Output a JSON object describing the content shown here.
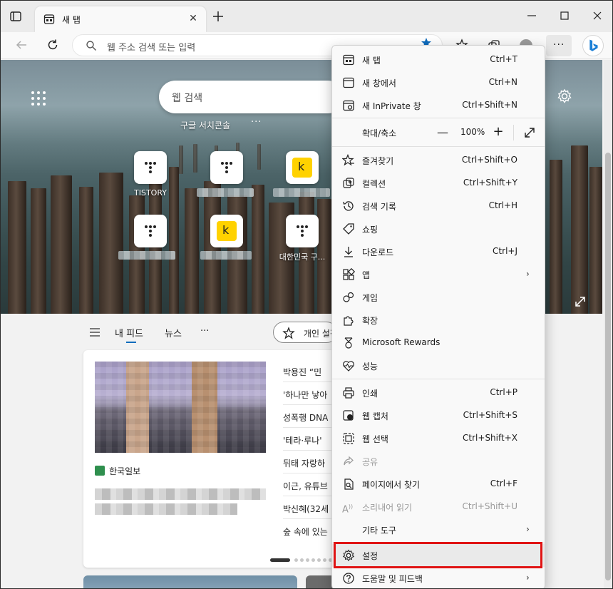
{
  "tab": {
    "title": "새 탭"
  },
  "address": {
    "placeholder": "웹 주소 검색 또는 입력"
  },
  "newtab": {
    "search_placeholder": "웹 검색",
    "search_sub": "구글 서치콘솔",
    "search_sub_more": "···",
    "tiles": [
      {
        "label": "TISTORY",
        "icon": "tistory-icon"
      },
      {
        "label": "",
        "icon": "tistory-icon"
      },
      {
        "label": "",
        "icon": "kakao-icon"
      },
      {
        "label": "",
        "icon": "tistory-icon"
      },
      {
        "label": "",
        "icon": "kakao-icon"
      },
      {
        "label": "대한민국 구...",
        "icon": "tistory-icon"
      }
    ]
  },
  "feed": {
    "tabs": [
      "내 피드",
      "뉴스"
    ],
    "more": "···",
    "personalize": "개인 설정",
    "publisher": "한국일보",
    "headlines": [
      "박용진 “민",
      "'하나만 낳아",
      "성폭행 DNA",
      "'테라·루나'",
      "뒤태 자랑하",
      "이근, 유튜브",
      "박신혜(32세",
      "숲 속에 있는"
    ]
  },
  "menu": {
    "items": [
      {
        "label": "새 탭",
        "shortcut": "Ctrl+T",
        "icon": "new-tab-icon"
      },
      {
        "label": "새 창에서",
        "shortcut": "Ctrl+N",
        "icon": "new-window-icon"
      },
      {
        "label": "새 InPrivate 창",
        "shortcut": "Ctrl+Shift+N",
        "icon": "inprivate-icon"
      },
      {
        "label": "확대/축소",
        "zoom": "100%",
        "icon": ""
      },
      {
        "label": "즐겨찾기",
        "shortcut": "Ctrl+Shift+O",
        "icon": "favorites-icon"
      },
      {
        "label": "컬렉션",
        "shortcut": "Ctrl+Shift+Y",
        "icon": "collections-icon"
      },
      {
        "label": "검색 기록",
        "shortcut": "Ctrl+H",
        "icon": "history-icon"
      },
      {
        "label": "쇼핑",
        "shortcut": "",
        "icon": "shopping-tag-icon"
      },
      {
        "label": "다운로드",
        "shortcut": "Ctrl+J",
        "icon": "download-icon"
      },
      {
        "label": "앱",
        "shortcut": "",
        "icon": "apps-icon",
        "submenu": true
      },
      {
        "label": "게임",
        "shortcut": "",
        "icon": "games-icon"
      },
      {
        "label": "확장",
        "shortcut": "",
        "icon": "extensions-icon"
      },
      {
        "label": "Microsoft Rewards",
        "shortcut": "",
        "icon": "rewards-icon"
      },
      {
        "label": "성능",
        "shortcut": "",
        "icon": "performance-icon"
      },
      {
        "label": "인쇄",
        "shortcut": "Ctrl+P",
        "icon": "print-icon"
      },
      {
        "label": "웹 캡처",
        "shortcut": "Ctrl+Shift+S",
        "icon": "web-capture-icon"
      },
      {
        "label": "웹 선택",
        "shortcut": "Ctrl+Shift+X",
        "icon": "web-select-icon"
      },
      {
        "label": "공유",
        "shortcut": "",
        "icon": "share-icon",
        "disabled": true
      },
      {
        "label": "페이지에서 찾기",
        "shortcut": "Ctrl+F",
        "icon": "find-icon"
      },
      {
        "label": "소리내어 읽기",
        "shortcut": "Ctrl+Shift+U",
        "icon": "read-aloud-icon",
        "disabled": true
      },
      {
        "label": "기타 도구",
        "shortcut": "",
        "icon": "",
        "submenu": true
      },
      {
        "label": "설정",
        "shortcut": "",
        "icon": "settings-icon"
      },
      {
        "label": "도움말 및 피드백",
        "shortcut": "",
        "icon": "help-icon",
        "submenu": true
      }
    ]
  },
  "colors": {
    "highlight": "#e01414",
    "accent": "#0f6cbd"
  }
}
